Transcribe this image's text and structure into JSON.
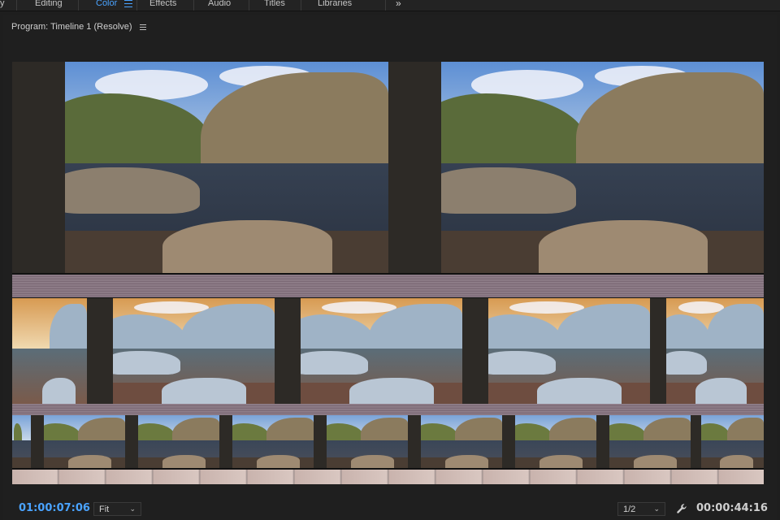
{
  "workspace": {
    "tabs": [
      {
        "label": "Editing"
      },
      {
        "label": "Color"
      },
      {
        "label": "Effects"
      },
      {
        "label": "Audio"
      },
      {
        "label": "Titles"
      },
      {
        "label": "Libraries"
      }
    ],
    "active_tab": "Color",
    "accent_color": "#4aa3ff",
    "more_label": "»"
  },
  "panel": {
    "title": "Program: Timeline 1 (Resolve)",
    "menu_icon": "hamburger-menu-icon"
  },
  "footer": {
    "playhead_timecode": "01:00:07:06",
    "zoom_label": "Fit",
    "resolution_label": "1/2",
    "settings_icon": "wrench-icon",
    "duration_timecode": "00:00:44:16"
  }
}
